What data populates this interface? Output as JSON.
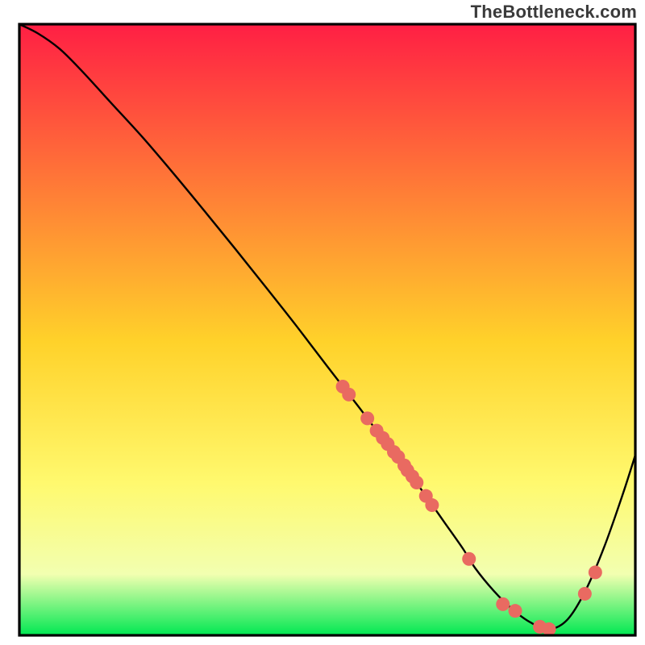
{
  "watermark": "TheBottleneck.com",
  "colors": {
    "frame": "#000000",
    "curve": "#000000",
    "dot": "#e96a61",
    "grad_top": "#ff1f44",
    "grad_mid1": "#ffd22a",
    "grad_mid2": "#fff96e",
    "grad_mid3": "#f2ffb0",
    "grad_bottom": "#00e852"
  },
  "chart_data": {
    "type": "line",
    "title": "",
    "xlabel": "",
    "ylabel": "",
    "xlim": [
      0,
      100
    ],
    "ylim": [
      0,
      100
    ],
    "grid": false,
    "legend": false,
    "series": [
      {
        "name": "bottleneck-curve",
        "x": [
          0,
          3,
          6.5,
          10,
          15,
          20,
          25,
          30,
          35,
          40,
          45,
          50,
          55,
          58,
          60,
          63,
          66,
          69,
          72,
          74,
          77,
          80,
          83,
          86,
          89,
          92,
          95,
          98,
          100
        ],
        "y": [
          100,
          98.5,
          96,
          92.5,
          87,
          81.5,
          75.6,
          69.5,
          63.3,
          57,
          50.6,
          44,
          37.5,
          33.5,
          31,
          27,
          22.8,
          18.5,
          14.2,
          11,
          7.3,
          4.3,
          2.1,
          1.0,
          2.6,
          7.5,
          14.6,
          23.2,
          29.5
        ]
      }
    ],
    "highlight_points": {
      "name": "curve-dots",
      "x": [
        52.5,
        53.5,
        56.5,
        58,
        59,
        59.8,
        60.8,
        61.5,
        62.5,
        63,
        63.8,
        64.5,
        66,
        67,
        73,
        78.5,
        80.5,
        84.5,
        86,
        91.8,
        93.5
      ],
      "y": [
        40.7,
        39.4,
        35.5,
        33.5,
        32.3,
        31.3,
        30.0,
        29.2,
        27.8,
        27.0,
        26.0,
        25.0,
        22.8,
        21.3,
        12.5,
        5.1,
        4.0,
        1.4,
        1.0,
        6.8,
        10.3
      ]
    }
  }
}
